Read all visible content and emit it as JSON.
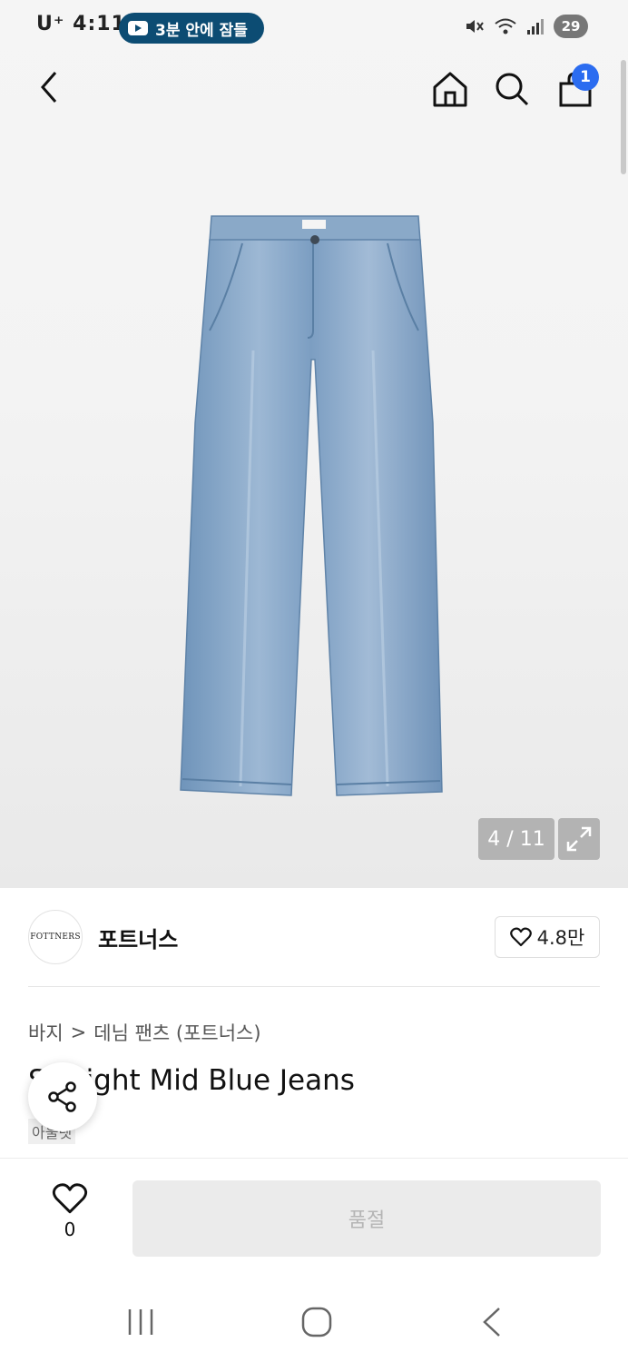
{
  "status_bar": {
    "carrier": "U⁺ 4:11",
    "notification_pill": "3분 안에 잠들",
    "battery": "29"
  },
  "nav": {
    "cart_count": "1"
  },
  "gallery": {
    "counter": "4 / 11"
  },
  "brand": {
    "logo_text": "FOTTNERS",
    "name": "포트너스",
    "likes": "4.8만"
  },
  "breadcrumb": {
    "category": "바지",
    "separator": ">",
    "subcategory": "데님 팬츠 (포트너스)"
  },
  "product": {
    "title": "Straight Mid Blue Jeans",
    "tag": "아울렛"
  },
  "action_bar": {
    "wish_count": "0",
    "buy_label": "품절"
  },
  "colors": {
    "accent_badge": "#2b6cf0",
    "notification": "#0c4c73",
    "disabled_button": "#ebebeb"
  }
}
